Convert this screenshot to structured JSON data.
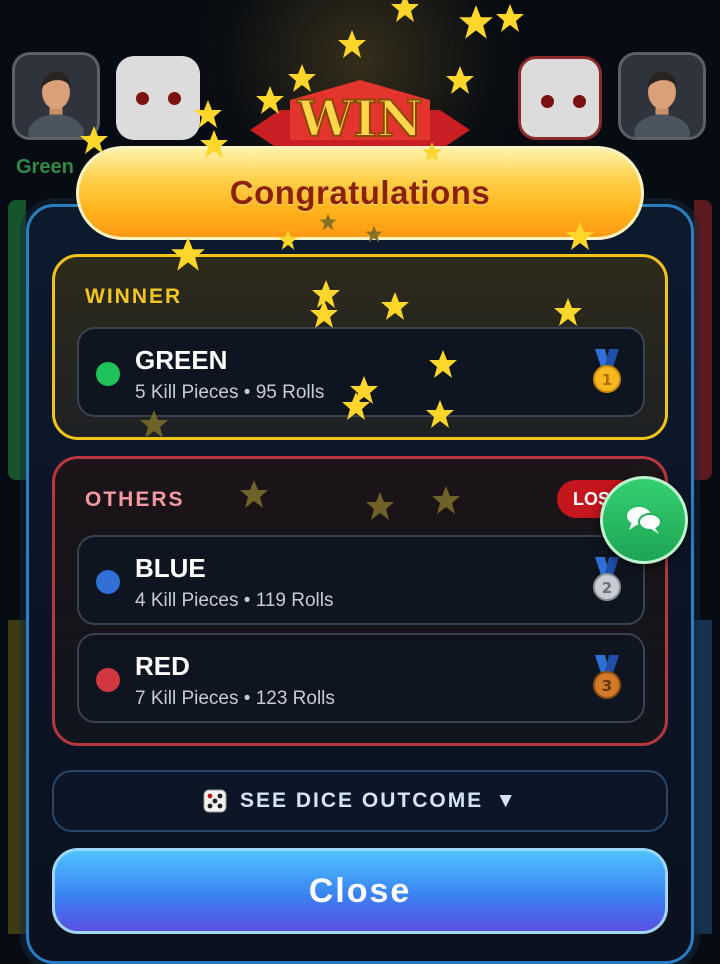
{
  "background": {
    "left_player_label": "Green"
  },
  "header": {
    "win_label": "WIN",
    "title": "Congratulations"
  },
  "winner": {
    "section_label": "WINNER",
    "name": "GREEN",
    "stats": "5 Kill Pieces • 95 Rolls",
    "color": "#1fc25a",
    "medal": "1"
  },
  "others": {
    "section_label": "OTHERS",
    "badge": "LOSE",
    "players": [
      {
        "name": "BLUE",
        "stats": "4 Kill Pieces • 119 Rolls",
        "color": "#2f6fd6",
        "medal": "2"
      },
      {
        "name": "RED",
        "stats": "7 Kill Pieces • 123 Rolls",
        "color": "#d1373f",
        "medal": "3"
      }
    ]
  },
  "actions": {
    "dice_outcome_label": "SEE DICE OUTCOME",
    "dice_icon": "dice-icon",
    "dropdown_icon": "▼",
    "close_label": "Close",
    "chat_icon": "chat-icon"
  },
  "colors": {
    "winner_border": "#f0c419",
    "others_border": "#b8363e",
    "lose_badge": "#c4161c",
    "modal_border": "#2a7fc2",
    "close_gradient_top": "#4fc3ff"
  }
}
